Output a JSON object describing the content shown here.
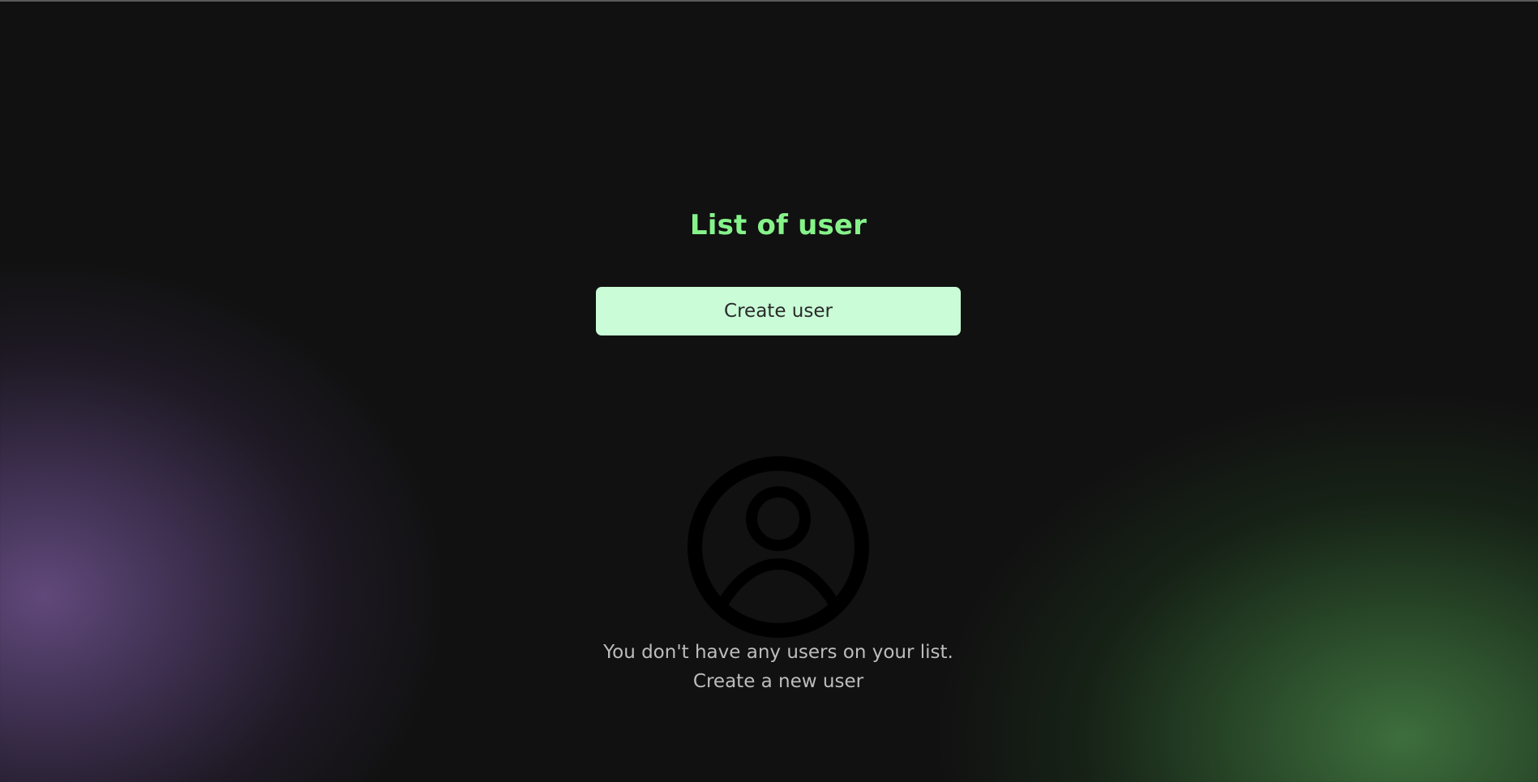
{
  "page": {
    "title": "List of user"
  },
  "actions": {
    "create_user_label": "Create user"
  },
  "empty_state": {
    "icon": "user-circle-icon",
    "message_line_1": "You don't have any users on your list.",
    "message_line_2": "Create a new user"
  },
  "colors": {
    "background": "#111111",
    "title": "#86f38a",
    "button_bg": "#c9fcd7",
    "button_text": "#2a2a2a",
    "muted_text": "#bdbdbd",
    "glow_purple": "#624a7d",
    "glow_green": "#3e703e"
  }
}
